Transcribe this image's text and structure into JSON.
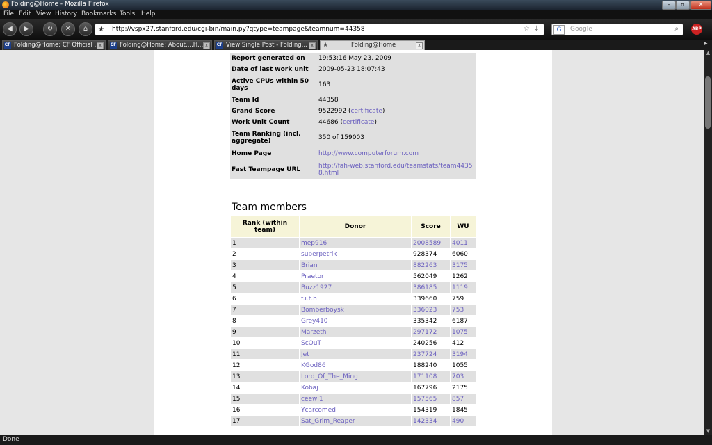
{
  "window": {
    "title": "Folding@Home - Mozilla Firefox"
  },
  "menu": [
    "File",
    "Edit",
    "View",
    "History",
    "Bookmarks",
    "Tools",
    "Help"
  ],
  "url": "http://vspx27.stanford.edu/cgi-bin/main.py?qtype=teampage&teamnum=44358",
  "search": {
    "placeholder": "Google",
    "engine": "G"
  },
  "tabs": [
    {
      "label": "Folding@Home: CF Official ..."
    },
    {
      "label": "Folding@Home: About....H..."
    },
    {
      "label": "View Single Post - Folding..."
    },
    {
      "label": "Folding@Home"
    }
  ],
  "info": [
    {
      "k": "Report generated on",
      "v": "19:53:16 May 23, 2009"
    },
    {
      "k": "Date of last work unit",
      "v": "2009-05-23 18:07:43"
    },
    {
      "k": "Active CPUs within 50 days",
      "v": "163"
    },
    {
      "k": "Team Id",
      "v": "44358"
    },
    {
      "k": "Grand Score",
      "v": "9522992 (",
      "link": "certificate",
      "after": ")"
    },
    {
      "k": "Work Unit Count",
      "v": "44686 (",
      "link": "certificate",
      "after": ")"
    },
    {
      "k": "Team Ranking (incl. aggregate)",
      "v": "350 of 159003"
    },
    {
      "k": "Home Page",
      "v": "",
      "link": "http://www.computerforum.com",
      "after": ""
    },
    {
      "k": "Fast Teampage URL",
      "v": "",
      "link": "http://fah-web.stanford.edu/teamstats/team44358.html",
      "after": ""
    }
  ],
  "members_title": "Team members",
  "members_headers": [
    "Rank (within team)",
    "Donor",
    "Score",
    "WU"
  ],
  "members": [
    {
      "rank": "1",
      "donor": "mep916",
      "score": "2008589",
      "wu": "4011"
    },
    {
      "rank": "2",
      "donor": "superpetrik",
      "score": "928374",
      "wu": "6060"
    },
    {
      "rank": "3",
      "donor": "Brian",
      "score": "882263",
      "wu": "3175"
    },
    {
      "rank": "4",
      "donor": "Praetor",
      "score": "562049",
      "wu": "1262"
    },
    {
      "rank": "5",
      "donor": "Buzz1927",
      "score": "386185",
      "wu": "1119"
    },
    {
      "rank": "6",
      "donor": "f.i.t.h",
      "score": "339660",
      "wu": "759"
    },
    {
      "rank": "7",
      "donor": "Bomberboysk",
      "score": "336023",
      "wu": "753"
    },
    {
      "rank": "8",
      "donor": "Grey410",
      "score": "335342",
      "wu": "6187"
    },
    {
      "rank": "9",
      "donor": "Marzeth",
      "score": "297172",
      "wu": "1075"
    },
    {
      "rank": "10",
      "donor": "ScOuT",
      "score": "240256",
      "wu": "412"
    },
    {
      "rank": "11",
      "donor": "Jet",
      "score": "237724",
      "wu": "3194"
    },
    {
      "rank": "12",
      "donor": "KGod86",
      "score": "188240",
      "wu": "1055"
    },
    {
      "rank": "13",
      "donor": "Lord_Of_The_Ming",
      "score": "171108",
      "wu": "703"
    },
    {
      "rank": "14",
      "donor": "Kobaj",
      "score": "167796",
      "wu": "2175"
    },
    {
      "rank": "15",
      "donor": "ceewi1",
      "score": "157565",
      "wu": "857"
    },
    {
      "rank": "16",
      "donor": "Ycarcomed",
      "score": "154319",
      "wu": "1845"
    },
    {
      "rank": "17",
      "donor": "Sat_Grim_Reaper",
      "score": "142334",
      "wu": "490"
    }
  ],
  "status": "Done",
  "colors": {
    "link": "#6a5fbf",
    "row_shade": "#e0e0e0",
    "header_bg": "#f6f4d8"
  }
}
